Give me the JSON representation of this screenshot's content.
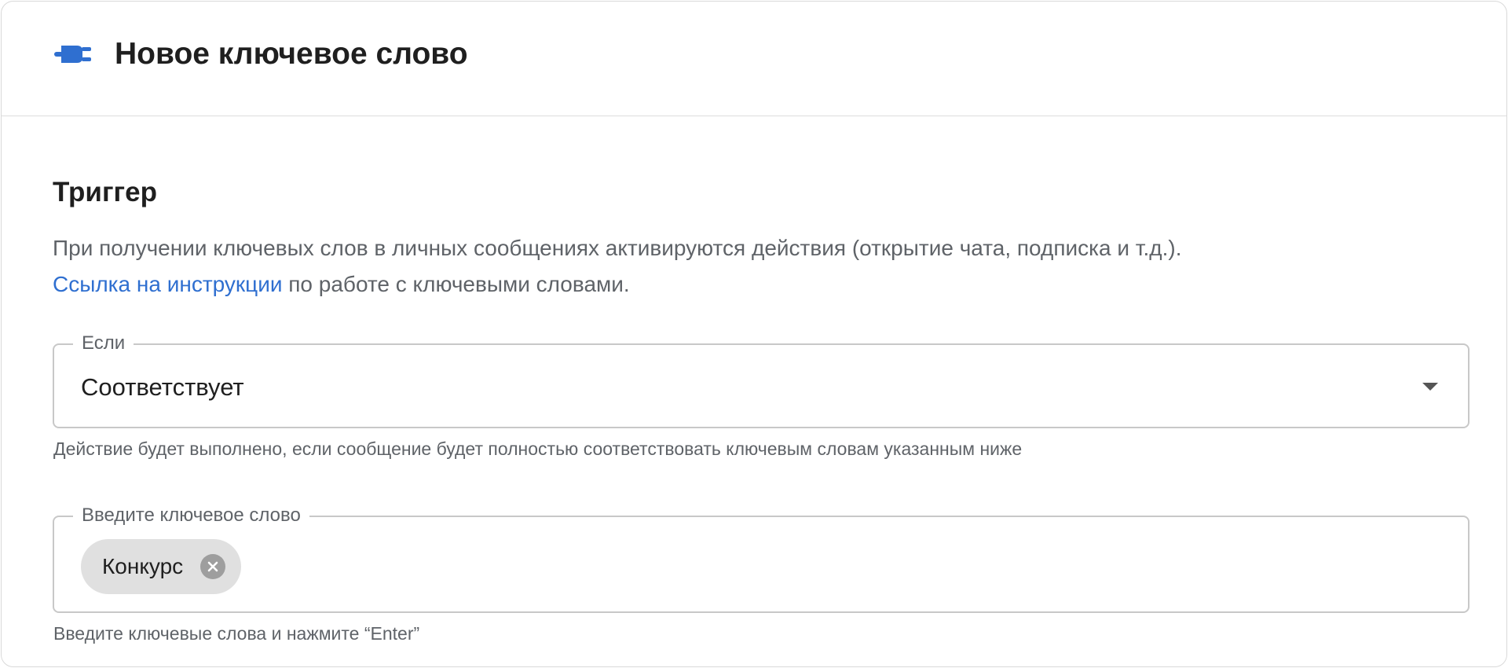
{
  "header": {
    "title": "Новое ключевое слово",
    "icon": "plug-icon",
    "icon_color": "#2f6fd0"
  },
  "trigger": {
    "title": "Триггер",
    "description": "При получении ключевых слов в личных сообщениях активируются действия (открытие чата, подписка и т.д.).",
    "link_text": "Ссылка на инструкции",
    "link_suffix": " по работе с ключевыми словами."
  },
  "condition_select": {
    "legend": "Если",
    "value": "Соответствует",
    "helper": "Действие будет выполнено, если сообщение будет полностью соответствовать ключевым словам указанным ниже"
  },
  "keywords_field": {
    "legend": "Введите ключевое слово",
    "chips": [
      {
        "label": "Конкурс"
      }
    ],
    "helper": "Введите ключевые слова и нажмите “Enter”"
  }
}
